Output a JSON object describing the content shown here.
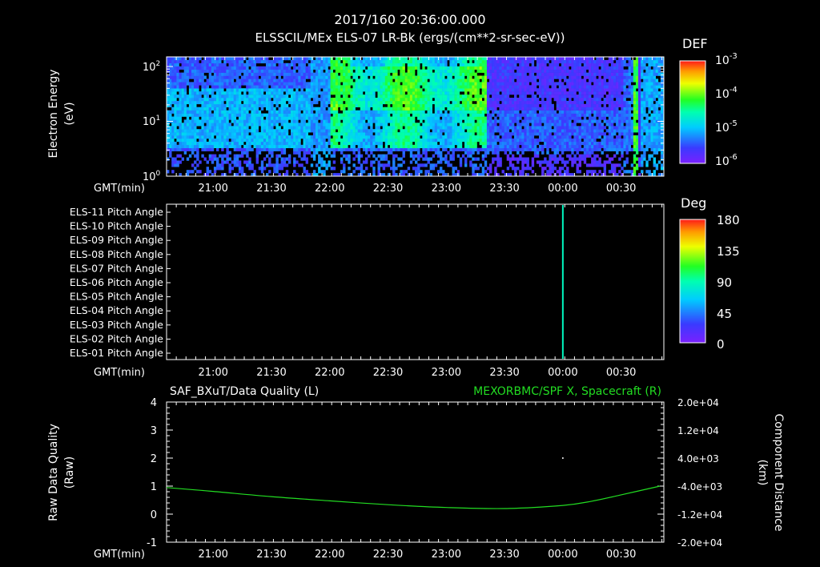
{
  "header": {
    "datetime": "2017/160 20:36:00.000",
    "title": "ELSSCIL/MEx ELS-07 LR-Bk  (ergs/(cm**2-sr-sec-eV))"
  },
  "colors": {
    "background": "#000000",
    "axis": "#ffffff",
    "spacecraft_series": "#22dd22"
  },
  "time_ticks": [
    "21:00",
    "21:30",
    "22:00",
    "22:30",
    "23:00",
    "23:30",
    "00:00",
    "00:30"
  ],
  "gmt_label": "GMT(min)",
  "chart_data": [
    {
      "type": "heatmap",
      "panel": "energy-spectrogram",
      "ylabel": "Electron Energy (eV)",
      "ylabel_line1": "Electron Energy",
      "ylabel_line2": "(eV)",
      "yscale": "log",
      "ylim": [
        1,
        150
      ],
      "yticks": [
        {
          "base": "10",
          "exp": "0"
        },
        {
          "base": "10",
          "exp": "1"
        },
        {
          "base": "10",
          "exp": "2"
        }
      ],
      "xlim": [
        "20:36",
        "00:52"
      ],
      "colorbar": {
        "label": "DEF",
        "scale": "log",
        "range": [
          1e-06,
          0.001
        ],
        "ticks": [
          {
            "base": "10",
            "exp": "-3"
          },
          {
            "base": "10",
            "exp": "-4"
          },
          {
            "base": "10",
            "exp": "-5"
          },
          {
            "base": "10",
            "exp": "-6"
          }
        ]
      },
      "features": [
        {
          "time": "20:36-21:50",
          "energy_range": [
            2,
            100
          ],
          "level": "1e-5"
        },
        {
          "time": "22:00-23:20",
          "energy_range": [
            2,
            150
          ],
          "level": "3e-5 to 1e-4"
        },
        {
          "time": "23:20-00:30",
          "energy_range": [
            2,
            60
          ],
          "level": "5e-6"
        },
        {
          "time": "00:35-00:40",
          "energy_range": [
            1,
            150
          ],
          "level": "1e-4"
        }
      ]
    },
    {
      "type": "heatmap",
      "panel": "pitch-angle",
      "rows": [
        "ELS-11 Pitch Angle",
        "ELS-10 Pitch Angle",
        "ELS-09 Pitch Angle",
        "ELS-08 Pitch Angle",
        "ELS-07 Pitch Angle",
        "ELS-06 Pitch Angle",
        "ELS-05 Pitch Angle",
        "ELS-04 Pitch Angle",
        "ELS-03 Pitch Angle",
        "ELS-02 Pitch Angle",
        "ELS-01 Pitch Angle"
      ],
      "colorbar": {
        "label": "Deg",
        "range": [
          0,
          180
        ],
        "ticks": [
          "180",
          "135",
          "90",
          "45",
          "0"
        ]
      },
      "markers": [
        {
          "time": "00:00",
          "value_deg": 85
        }
      ]
    },
    {
      "type": "line",
      "panel": "data-quality",
      "title_left": "SAF_BXuT/Data Quality (L)",
      "title_right": "MEXORBMC/SPF X, Spacecraft (R)",
      "ylabel_left_line1": "Raw Data Quality",
      "ylabel_left_line2": "(Raw)",
      "ylim_left": [
        -1,
        4
      ],
      "yticks_left": [
        "4",
        "3",
        "2",
        "1",
        "0",
        "-1"
      ],
      "ylabel_right_line1": "Component Distance",
      "ylabel_right_line2": "(km)",
      "ylim_right": [
        -20000,
        20000
      ],
      "yticks_right": [
        "2.0e+04",
        "1.2e+04",
        "4.0e+03",
        "-4.0e+03",
        "-1.2e+04",
        "-2.0e+04"
      ],
      "series": [
        {
          "name": "MEXORBMC/SPF X, Spacecraft (R)",
          "axis": "right",
          "x": [
            "20:36",
            "21:00",
            "21:30",
            "22:00",
            "22:30",
            "23:00",
            "23:30",
            "00:00",
            "00:15",
            "00:30",
            "00:50"
          ],
          "values": [
            -4400,
            -5500,
            -7000,
            -8200,
            -9300,
            -10100,
            -10400,
            -9500,
            -8300,
            -6500,
            -4000
          ]
        }
      ],
      "points": [
        {
          "time": "00:00",
          "value": 2.0
        }
      ]
    }
  ]
}
